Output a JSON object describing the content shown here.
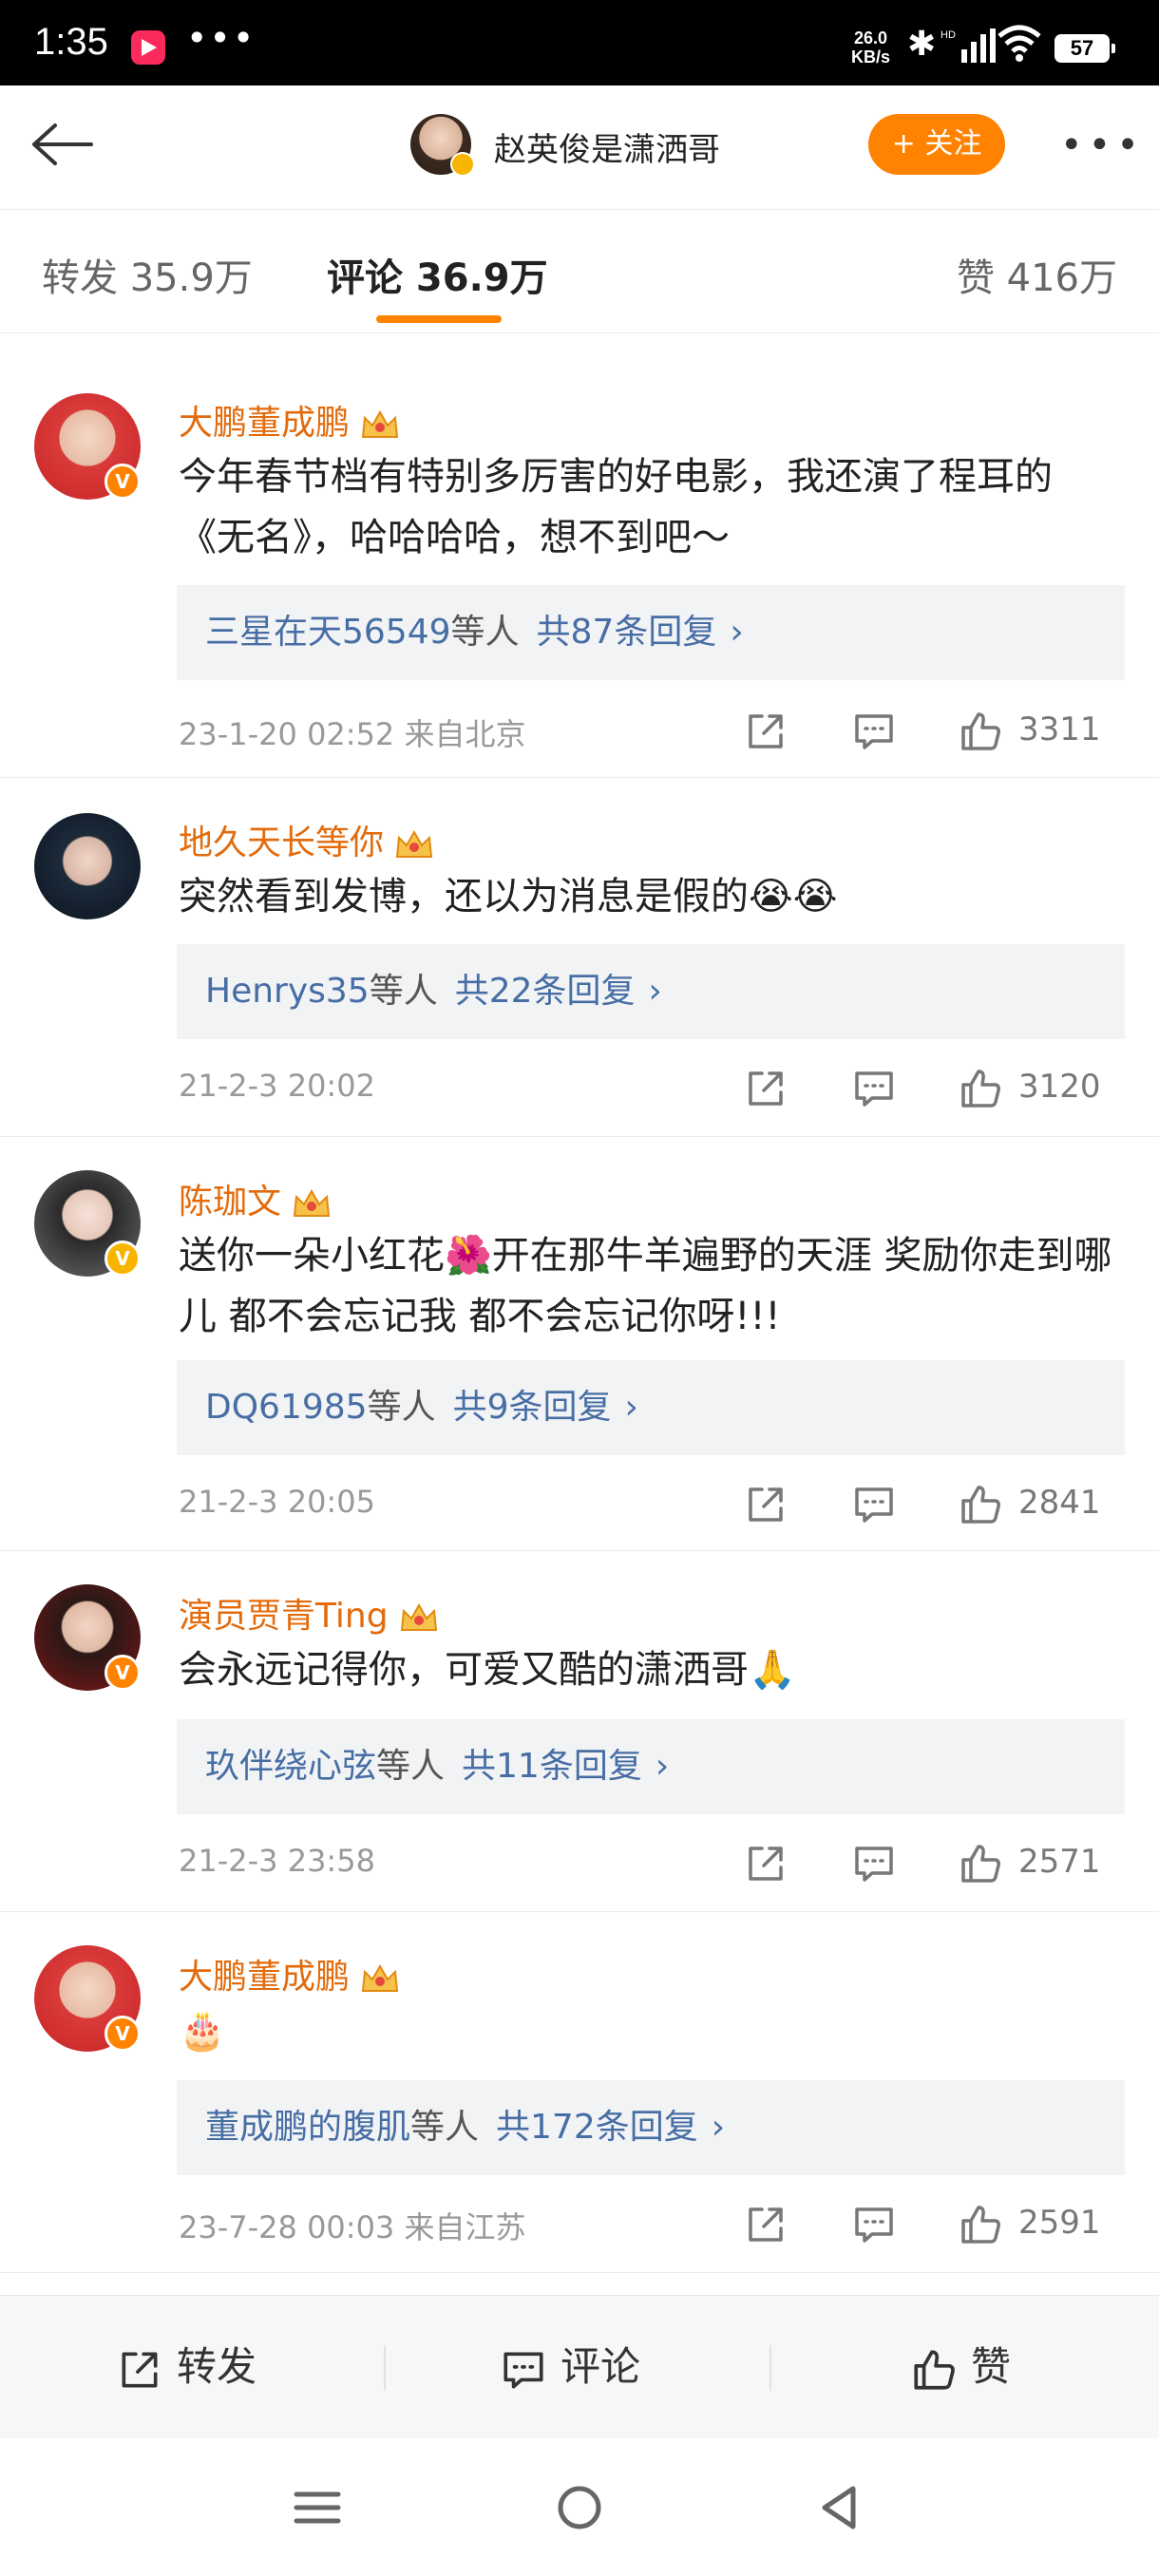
{
  "status_bar": {
    "time": "1:35",
    "dots": "•••",
    "net_speed_value": "26.0",
    "net_speed_unit": "KB/s",
    "bluetooth": "✱",
    "battery": "57"
  },
  "header": {
    "title": "赵英俊是潇洒哥",
    "follow_label": "+ 关注",
    "more": "•••"
  },
  "tabs": {
    "repost": "转发 35.9万",
    "comments": "评论 36.9万",
    "likes": "赞 416万"
  },
  "comments": [
    {
      "name": "大鹏董成鹏",
      "text": "今年春节档有特别多厉害的好电影，我还演了程耳的《无名》，哈哈哈哈，想不到吧～",
      "reply_users": "三星在天56549",
      "reply_mid": "等人",
      "reply_count": "共87条回复",
      "meta": "23-1-20 02:52  来自北京",
      "likes": "3311"
    },
    {
      "name": "地久天长等你",
      "text": "突然看到发博，还以为消息是假的😭😭",
      "reply_users": "Henrys35",
      "reply_mid": "等人",
      "reply_count": "共22条回复",
      "meta": "21-2-3 20:02",
      "likes": "3120"
    },
    {
      "name": "陈珈文",
      "text": "送你一朵小红花🌺开在那牛羊遍野的天涯 奖励你走到哪儿 都不会忘记我 都不会忘记你呀!!!",
      "reply_users": "DQ61985",
      "reply_mid": "等人",
      "reply_count": "共9条回复",
      "meta": "21-2-3 20:05",
      "likes": "2841"
    },
    {
      "name": "演员贾青Ting",
      "text": "会永远记得你，可爱又酷的潇洒哥🙏",
      "reply_users": "玖伴绕心弦",
      "reply_mid": "等人",
      "reply_count": "共11条回复",
      "meta": "21-2-3 23:58",
      "likes": "2571"
    },
    {
      "name": "大鹏董成鹏",
      "text": "🎂",
      "reply_users": "董成鹏的腹肌",
      "reply_mid": "等人",
      "reply_count": "共172条回复",
      "meta": "23-7-28 00:03  来自江苏",
      "likes": "2591"
    }
  ],
  "reply_arrow": "›",
  "bottom_bar": {
    "repost": "转发",
    "comment": "评论",
    "like": "赞"
  },
  "colors": {
    "accent": "#ff8200",
    "name": "#e36b0c",
    "link": "#476ea4"
  }
}
